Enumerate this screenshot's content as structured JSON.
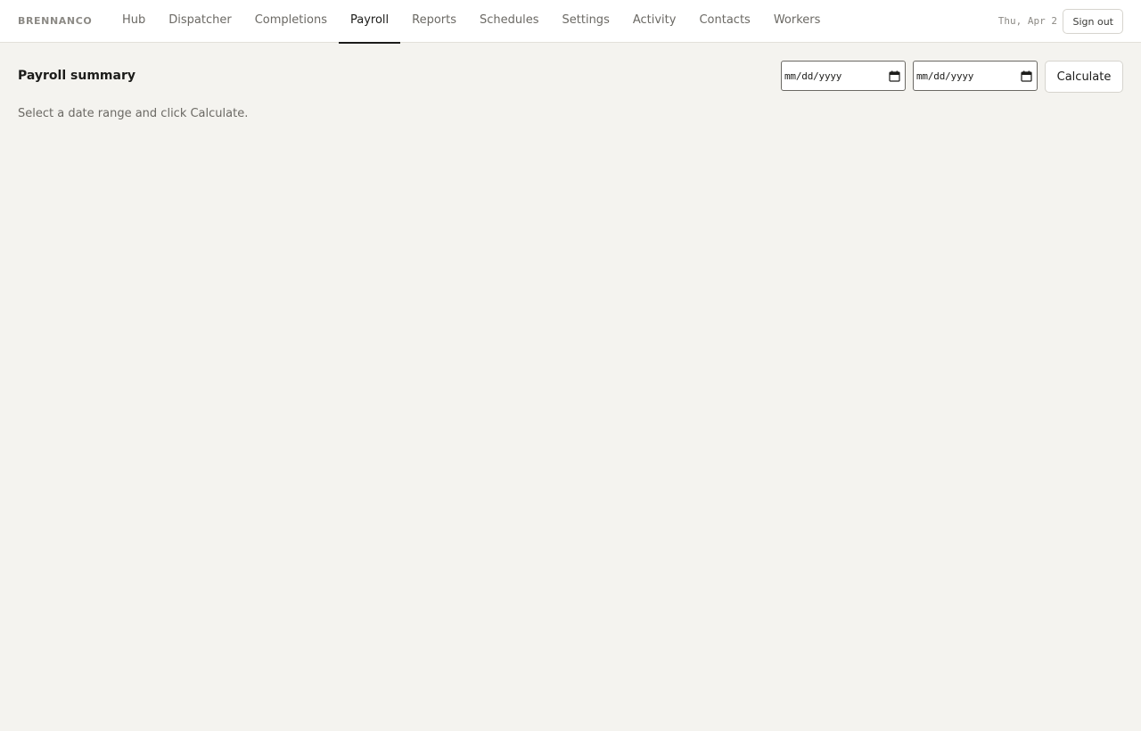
{
  "header": {
    "brand": "BRENNANCO",
    "nav": [
      {
        "label": "Hub"
      },
      {
        "label": "Dispatcher"
      },
      {
        "label": "Completions"
      },
      {
        "label": "Payroll",
        "active": true
      },
      {
        "label": "Reports"
      },
      {
        "label": "Schedules"
      },
      {
        "label": "Settings"
      },
      {
        "label": "Activity"
      },
      {
        "label": "Contacts"
      },
      {
        "label": "Workers"
      }
    ],
    "date": "Thu, Apr 2",
    "sign_out_label": "Sign out"
  },
  "main": {
    "title": "Payroll summary",
    "hint": "Select a date range and click Calculate.",
    "start_date": {
      "placeholder": "mm/dd/yyyy",
      "value": ""
    },
    "end_date": {
      "placeholder": "mm/dd/yyyy",
      "value": ""
    },
    "calculate_label": "Calculate"
  },
  "colors": {
    "background": "#f4f3ef",
    "active_tab_underline": "#1c1c1a"
  },
  "icons": {
    "date_picker": "calendar-icon"
  }
}
